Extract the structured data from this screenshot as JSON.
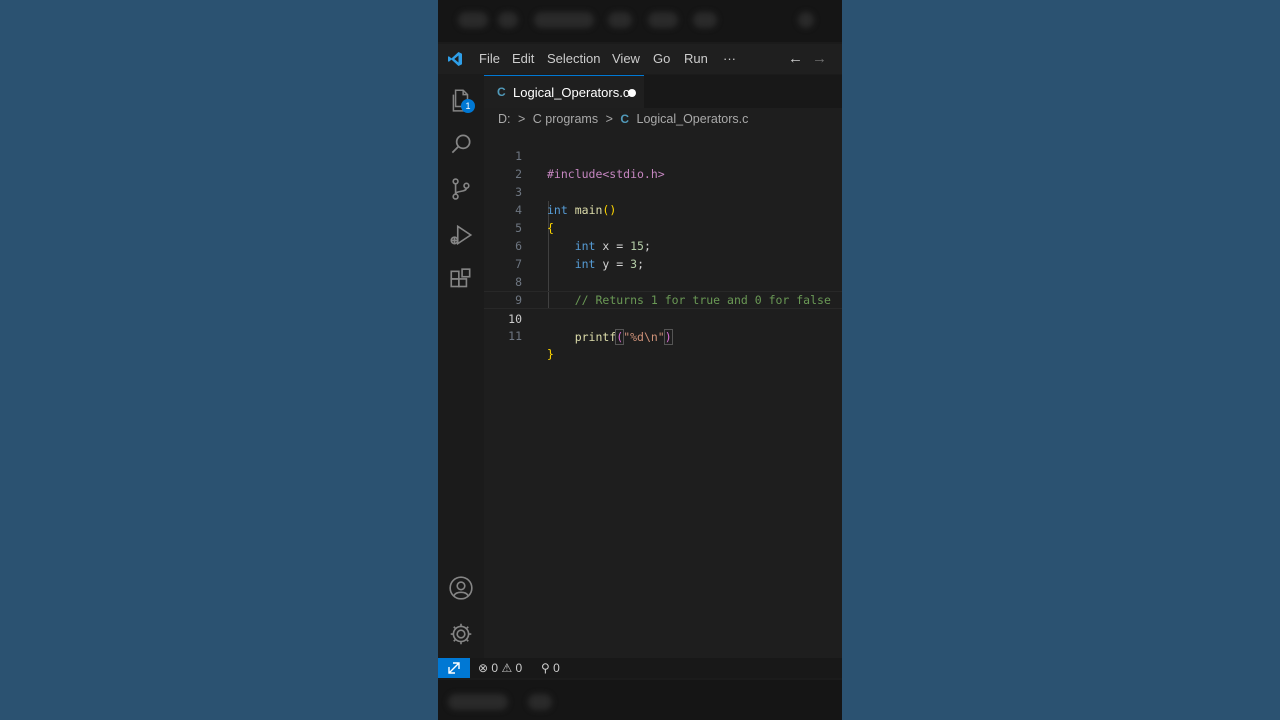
{
  "menu": {
    "items": [
      "File",
      "Edit",
      "Selection",
      "View",
      "Go",
      "Run"
    ],
    "more": "···",
    "back_arrow": "←",
    "forward_arrow": "→"
  },
  "activity_bar": {
    "explorer_badge": "1",
    "icons": [
      "files-icon",
      "search-icon",
      "source-control-icon",
      "run-debug-icon",
      "extensions-icon",
      "account-icon",
      "gear-icon"
    ]
  },
  "tab": {
    "icon": "C",
    "label": "Logical_Operators.c",
    "modified": true
  },
  "breadcrumb": {
    "drive": "D:",
    "sep": ">",
    "folder": "C programs",
    "file_icon": "C",
    "file": "Logical_Operators.c"
  },
  "code": {
    "active_line": 10,
    "line_numbers": [
      "1",
      "2",
      "3",
      "4",
      "5",
      "6",
      "7",
      "8",
      "9",
      "10",
      "11"
    ],
    "l1_directive": "#include<stdio.h>",
    "l3_type": "int",
    "l3_fn": "main",
    "l3_parens": "()",
    "l4": "{",
    "l5_type": "int",
    "l5_rest": "x = ",
    "l5_num": "15",
    "l5_semi": ";",
    "l6_type": "int",
    "l6_rest": "y = ",
    "l6_num": "3",
    "l6_semi": ";",
    "l8_comment": "// Returns 1 for true and 0 for false",
    "l10_fn": "printf",
    "l10_open": "(",
    "l10_str": "\"%d\\n\"",
    "l10_close": ")",
    "l11": "}"
  },
  "status_bar": {
    "remote_icon": "remote-icon",
    "errors": "0",
    "warnings": "0",
    "ports": "0"
  },
  "colors": {
    "accent": "#0078d4",
    "background_outer": "#2b5271",
    "editor_bg": "#1e1e1e"
  }
}
